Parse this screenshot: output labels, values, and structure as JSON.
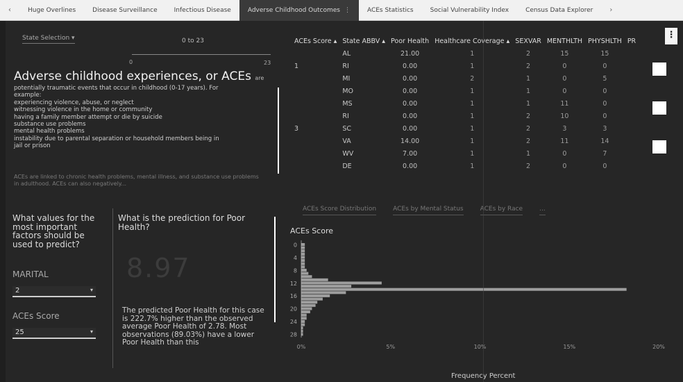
{
  "tabs": [
    "Huge Overlines",
    "Disease Surveillance",
    "Infectious Disease",
    "Adverse Childhood Outcomes",
    "ACEs Statistics",
    "Social Vulnerability Index",
    "Census Data Explorer"
  ],
  "active_tab_index": 3,
  "filter": {
    "state_selector": "State Selection",
    "range_label": "0 to 23",
    "slider_min": "0",
    "slider_max": "23"
  },
  "ace_intro": {
    "title": "Adverse childhood experiences, or ACEs",
    "title_suffix": "are",
    "lines": [
      "potentially traumatic events that occur in childhood (0-17 years). For",
      "example:",
      "experiencing violence, abuse, or neglect",
      "witnessing violence in the home or community",
      "having a family member attempt or die by suicide",
      "substance use problems",
      "mental health problems",
      "instability due to parental separation or household members being in",
      "jail or prison"
    ],
    "footer": "ACEs are linked to chronic health problems, mental illness, and substance use problems in adulthood. ACEs can also negatively..."
  },
  "prediction": {
    "question_left": "What values for the most important factors should be used to predict?",
    "question_right": "What is the prediction for Poor Health?",
    "field1_label": "MARITAL",
    "field1_value": "2",
    "field2_label": "ACEs Score",
    "field2_value": "25",
    "value": "8.97",
    "description": "The predicted Poor Health for this case is 222.7% higher than the observed average Poor Health of 2.78. Most observations (89.03%) have a lower Poor Health than this"
  },
  "table": {
    "columns": [
      "ACEs Score ▴",
      "State ABBV ▴",
      "Poor Health",
      "Healthcare Coverage ▴",
      "SEXVAR",
      "MENTHLTH",
      "PHYSHLTH",
      "PR"
    ],
    "rows": [
      [
        "",
        "AL",
        "21.00",
        "1",
        "2",
        "15",
        "15"
      ],
      [
        "1",
        "RI",
        "0.00",
        "1",
        "2",
        "0",
        "0"
      ],
      [
        "",
        "MI",
        "0.00",
        "2",
        "1",
        "0",
        "5"
      ],
      [
        "",
        "MO",
        "0.00",
        "1",
        "1",
        "0",
        "0"
      ],
      [
        "",
        "MS",
        "0.00",
        "1",
        "1",
        "11",
        "0"
      ],
      [
        "",
        "RI",
        "0.00",
        "1",
        "2",
        "10",
        "0"
      ],
      [
        "3",
        "SC",
        "0.00",
        "1",
        "2",
        "3",
        "3"
      ],
      [
        "",
        "VA",
        "14.00",
        "1",
        "2",
        "11",
        "14"
      ],
      [
        "",
        "WV",
        "7.00",
        "1",
        "1",
        "0",
        "7"
      ],
      [
        "",
        "DE",
        "0.00",
        "1",
        "2",
        "0",
        "0"
      ]
    ]
  },
  "chart_tabs": [
    "ACEs Score Distribution",
    "ACEs by Mental Status",
    "ACEs by Race",
    "..."
  ],
  "chart_data": {
    "type": "bar",
    "orientation": "horizontal",
    "title": "ACEs Score",
    "xlabel": "Frequency Percent",
    "ylabel": "ACEs Score",
    "y_tick_labels": [
      "0",
      "4",
      "8",
      "12",
      "16",
      "20",
      "24",
      "28"
    ],
    "x_tick_labels": [
      "0%",
      "5%",
      "10%",
      "15%",
      "20%"
    ],
    "xlim": [
      0,
      20
    ],
    "categories": [
      "0",
      "1",
      "2",
      "3",
      "4",
      "5",
      "6",
      "7",
      "8",
      "9",
      "10",
      "11",
      "12",
      "13",
      "14",
      "15",
      "16",
      "17",
      "18",
      "19",
      "20",
      "21",
      "22",
      "23",
      "24",
      "25",
      "26",
      "27",
      "28"
    ],
    "values": [
      0.2,
      0.2,
      0.2,
      0.2,
      0.2,
      0.2,
      0.2,
      0.2,
      0.3,
      0.4,
      0.6,
      1.5,
      4.5,
      2.8,
      18.2,
      2.5,
      1.6,
      1.2,
      0.9,
      0.8,
      0.6,
      0.5,
      0.3,
      0.3,
      0.2,
      0.2,
      0.1,
      0.1,
      0.1
    ]
  }
}
